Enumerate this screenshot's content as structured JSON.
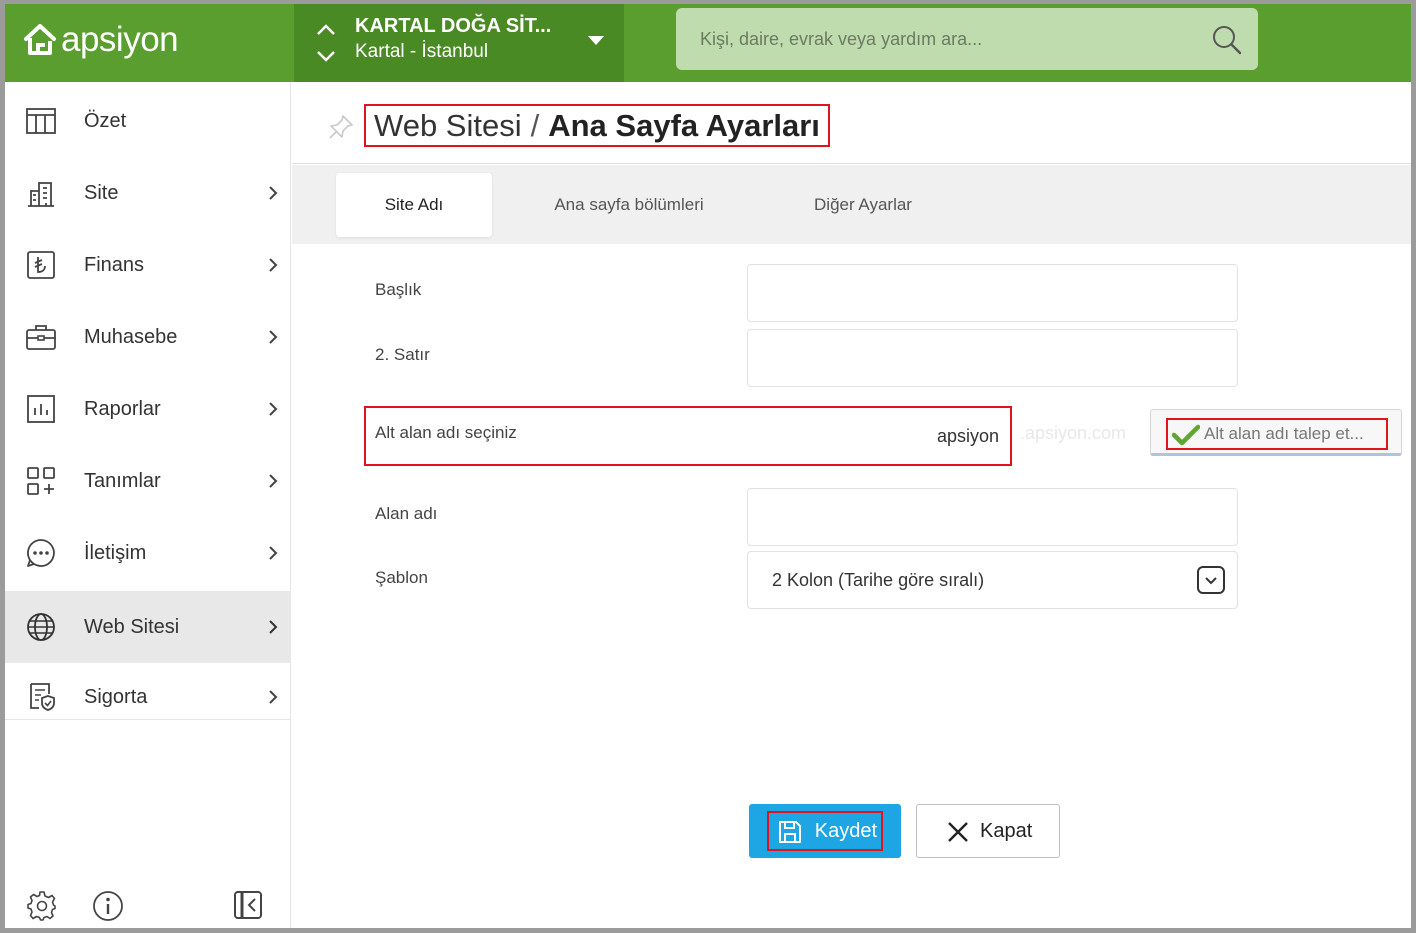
{
  "brand": {
    "logo_text": "apsiyon"
  },
  "site_switcher": {
    "name": "KARTAL DOĞA SİT...",
    "location": "Kartal - İstanbul"
  },
  "search": {
    "placeholder": "Kişi, daire, evrak veya yardım ara..."
  },
  "sidebar": {
    "items": [
      {
        "label": "Özet",
        "icon": "table-icon",
        "has_children": false
      },
      {
        "label": "Site",
        "icon": "building-icon",
        "has_children": true
      },
      {
        "label": "Finans",
        "icon": "lira-icon",
        "has_children": true
      },
      {
        "label": "Muhasebe",
        "icon": "briefcase-icon",
        "has_children": true
      },
      {
        "label": "Raporlar",
        "icon": "report-chart-icon",
        "has_children": true
      },
      {
        "label": "Tanımlar",
        "icon": "grid-plus-icon",
        "has_children": true
      },
      {
        "label": "İletişim",
        "icon": "chat-dots-icon",
        "has_children": true
      },
      {
        "label": "Web Sitesi",
        "icon": "globe-icon",
        "has_children": true,
        "active": true
      },
      {
        "label": "Sigorta",
        "icon": "insurance-doc-icon",
        "has_children": true
      }
    ],
    "footer_icons": [
      "settings-icon",
      "info-icon",
      "collapse-sidebar-icon"
    ]
  },
  "page": {
    "title_section": "Web Sitesi",
    "title_separator": "/",
    "title_page": "Ana Sayfa Ayarları"
  },
  "tabs": [
    {
      "label": "Site Adı",
      "active": true
    },
    {
      "label": "Ana sayfa bölümleri",
      "active": false
    },
    {
      "label": "Diğer Ayarlar",
      "active": false
    }
  ],
  "form": {
    "baslik_label": "Başlık",
    "baslik_value": "",
    "satir2_label": "2. Satır",
    "satir2_value": "",
    "subdomain_label": "Alt alan adı seçiniz",
    "subdomain_value": "apsiyon",
    "subdomain_suffix": ".apsiyon.com",
    "subdomain_request_button": "Alt alan adı talep et...",
    "alanadi_label": "Alan adı",
    "alanadi_value": "",
    "sablon_label": "Şablon",
    "sablon_value": "2 Kolon (Tarihe göre sıralı)"
  },
  "actions": {
    "save_label": "Kaydet",
    "close_label": "Kapat"
  },
  "colors": {
    "header_green": "#5a9e2f",
    "switcher_green": "#4a8a25",
    "search_bg": "#bfdcae",
    "primary_blue": "#1ea5e4",
    "highlight_red": "#e0141e"
  }
}
